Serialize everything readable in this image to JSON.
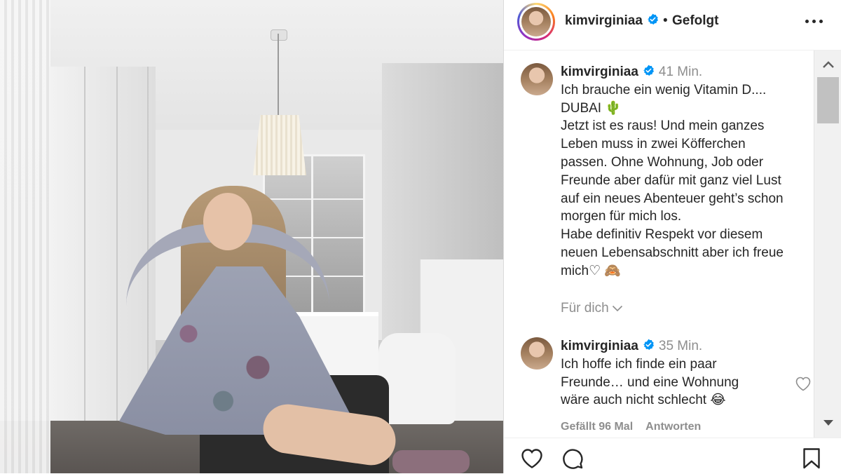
{
  "post": {
    "username": "kimvirginiaa",
    "follow_status": "Gefolgt",
    "separator": "•"
  },
  "icons": {
    "verified": "verified-badge-icon",
    "more": "more-options-icon",
    "like": "heart-icon",
    "comment": "comment-icon",
    "save": "bookmark-icon",
    "translate_toggle": "chevron-down-icon"
  },
  "colors": {
    "verified_blue": "#0095f6",
    "text": "#262626",
    "secondary_text": "#8e8e8e"
  },
  "caption": {
    "username": "kimvirginiaa",
    "time": "41 Min.",
    "lines": [
      "Ich brauche ein wenig Vitamin D....",
      "DUBAI 🌵",
      "Jetzt ist es raus! Und mein ganzes",
      "Leben muss in zwei Köfferchen",
      "passen. Ohne Wohnung, Job oder",
      "Freunde aber dafür mit ganz viel Lust",
      "auf ein neues Abenteuer geht’s schon",
      "morgen für mich los.",
      "Habe definitiv Respekt vor diesem",
      "neuen Lebensabschnitt aber ich freue",
      "mich♡ 🙈"
    ],
    "translate_label": "Für dich"
  },
  "comment": {
    "username": "kimvirginiaa",
    "time": "35 Min.",
    "lines": [
      "Ich hoffe ich finde ein paar",
      "Freunde… und eine Wohnung",
      "wäre auch nicht schlecht 😂"
    ],
    "likes": "Gefällt 96 Mal",
    "reply": "Antworten"
  }
}
